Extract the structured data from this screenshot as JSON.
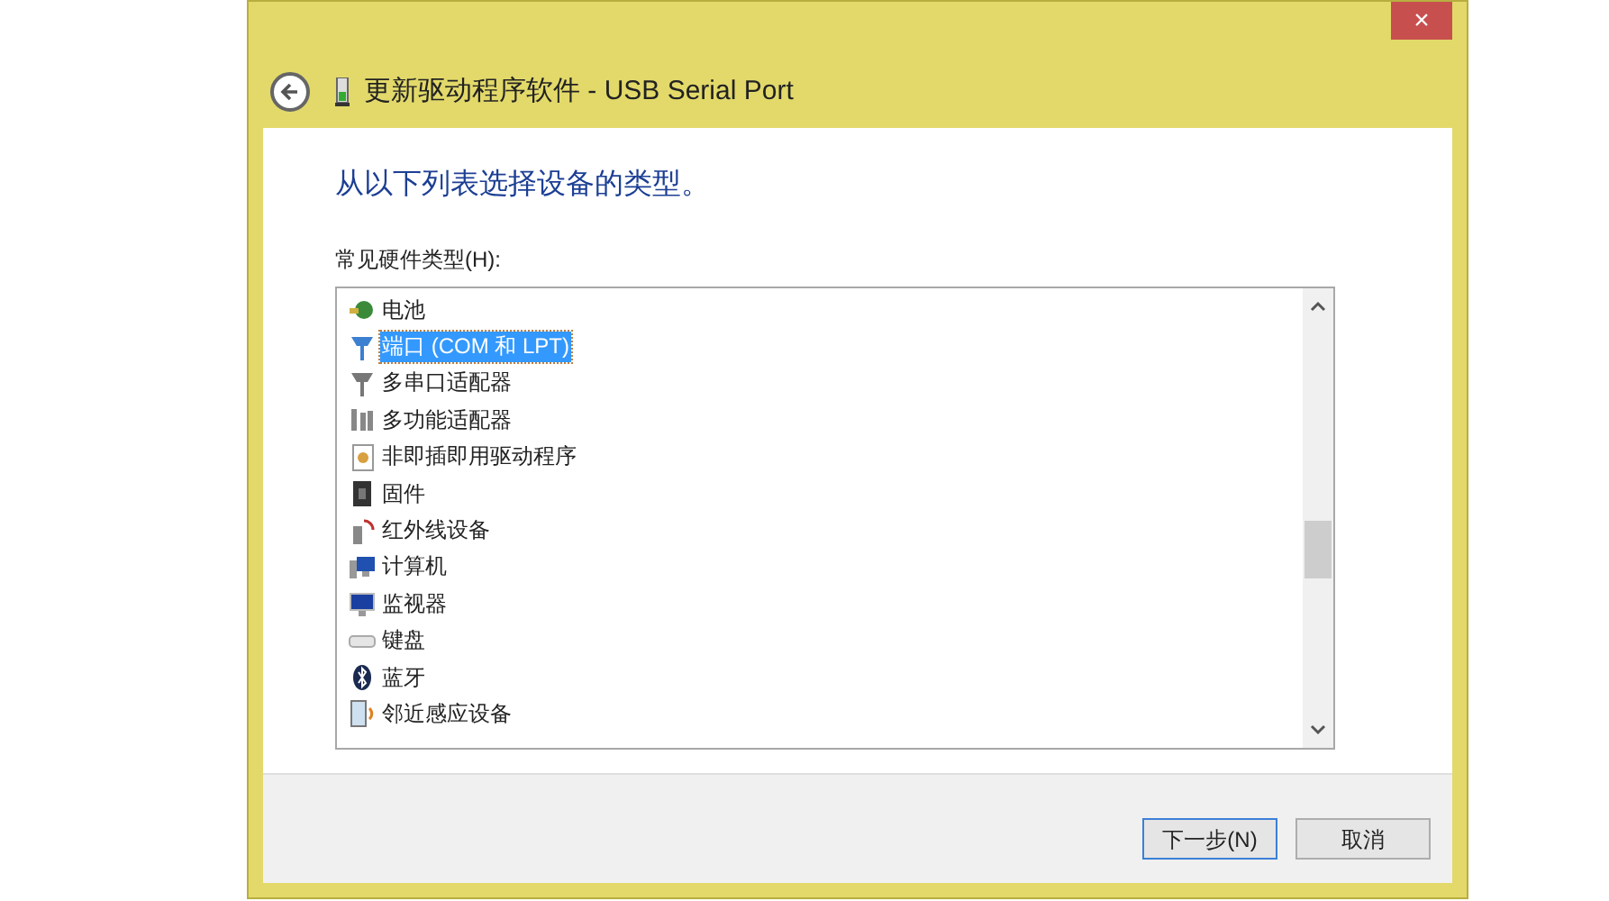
{
  "window": {
    "title": "更新驱动程序软件 - USB Serial Port",
    "close": "×"
  },
  "heading": "从以下列表选择设备的类型。",
  "list_label": "常见硬件类型(H):",
  "items": [
    {
      "label": "电池",
      "selected": false
    },
    {
      "label": "端口 (COM 和 LPT)",
      "selected": true
    },
    {
      "label": "多串口适配器",
      "selected": false
    },
    {
      "label": "多功能适配器",
      "selected": false
    },
    {
      "label": "非即插即用驱动程序",
      "selected": false
    },
    {
      "label": "固件",
      "selected": false
    },
    {
      "label": "红外线设备",
      "selected": false
    },
    {
      "label": "计算机",
      "selected": false
    },
    {
      "label": "监视器",
      "selected": false
    },
    {
      "label": "键盘",
      "selected": false
    },
    {
      "label": "蓝牙",
      "selected": false
    },
    {
      "label": "邻近感应设备",
      "selected": false
    }
  ],
  "buttons": [
    {
      "label": "下一步(N)",
      "default": true
    },
    {
      "label": "取消",
      "default": false
    }
  ]
}
